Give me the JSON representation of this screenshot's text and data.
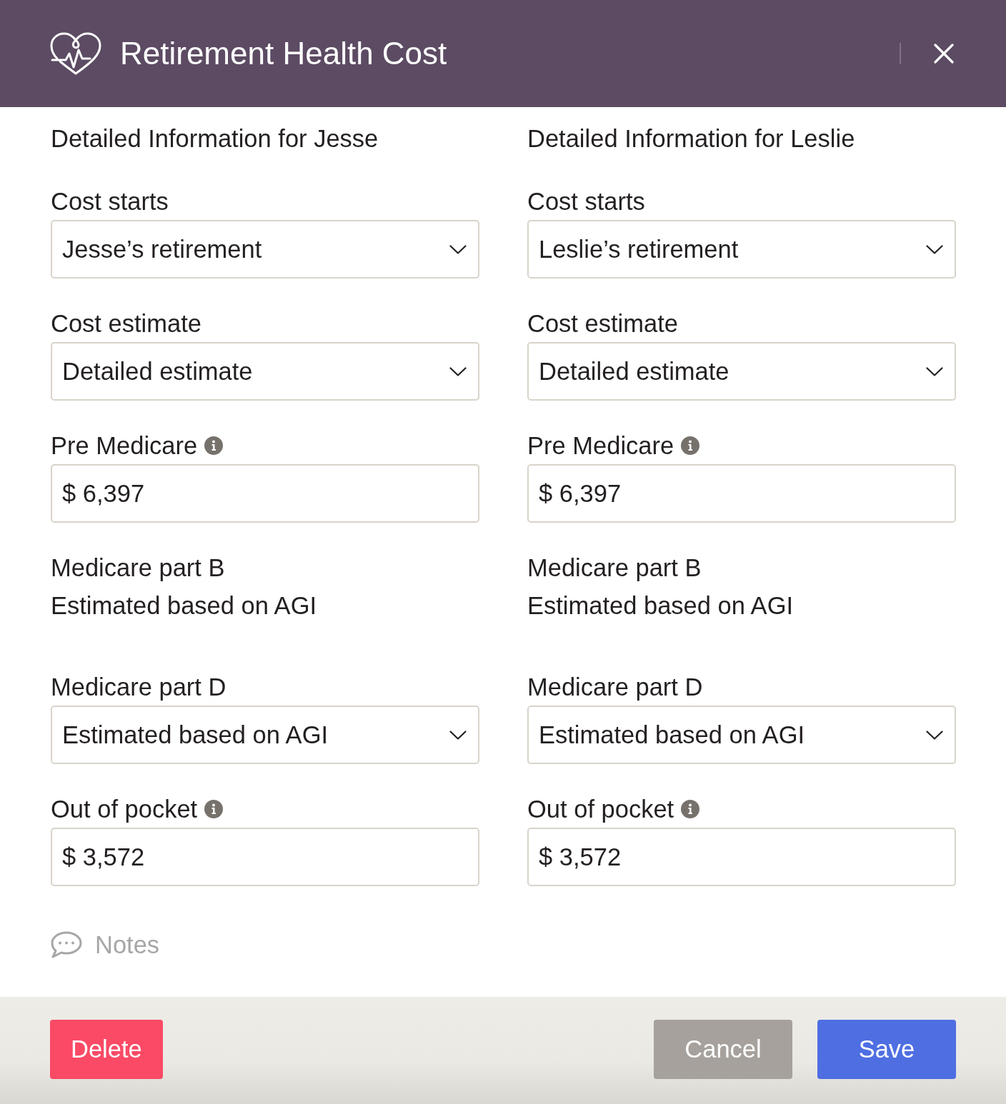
{
  "dialog": {
    "title": "Retirement Health Cost"
  },
  "columns": [
    {
      "heading": "Detailed Information for Jesse",
      "fields": [
        {
          "kind": "select",
          "label": "Cost starts",
          "info": false,
          "value": "Jesse’s retirement"
        },
        {
          "kind": "select",
          "label": "Cost estimate",
          "info": false,
          "value": "Detailed estimate"
        },
        {
          "kind": "input",
          "label": "Pre Medicare",
          "info": true,
          "value": "$ 6,397"
        },
        {
          "kind": "static",
          "label": "Medicare part B",
          "info": false,
          "value": "Estimated based on AGI"
        },
        {
          "kind": "select",
          "label": "Medicare part D",
          "info": false,
          "value": "Estimated based on AGI"
        },
        {
          "kind": "input",
          "label": "Out of pocket",
          "info": true,
          "value": "$ 3,572"
        }
      ]
    },
    {
      "heading": "Detailed Information for Leslie",
      "fields": [
        {
          "kind": "select",
          "label": "Cost starts",
          "info": false,
          "value": "Leslie’s retirement"
        },
        {
          "kind": "select",
          "label": "Cost estimate",
          "info": false,
          "value": "Detailed estimate"
        },
        {
          "kind": "input",
          "label": "Pre Medicare",
          "info": true,
          "value": "$ 6,397"
        },
        {
          "kind": "static",
          "label": "Medicare part B",
          "info": false,
          "value": "Estimated based on AGI"
        },
        {
          "kind": "select",
          "label": "Medicare part D",
          "info": false,
          "value": "Estimated based on AGI"
        },
        {
          "kind": "input",
          "label": "Out of pocket",
          "info": true,
          "value": "$ 3,572"
        }
      ]
    }
  ],
  "notes": {
    "label": "Notes"
  },
  "buttons": [
    {
      "kind": "danger",
      "label": "Delete"
    },
    {
      "kind": "secondary",
      "label": "Cancel"
    },
    {
      "kind": "primary",
      "label": "Save"
    }
  ]
}
